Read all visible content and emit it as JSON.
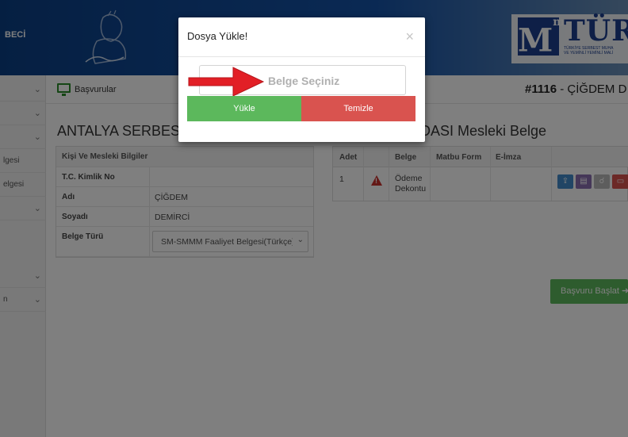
{
  "header": {
    "brand_text": "BECİ",
    "logo_letter": "M",
    "logo_sup": "m",
    "logo_word": "TÜR",
    "logo_sub_line1": "TÜRKİYE SERBEST MUHA",
    "logo_sub_line2": "VE YEMİNLİ YEMİNLİ MALİ"
  },
  "sidebar": {
    "items": [
      {
        "label": "",
        "has_chevron": true
      },
      {
        "label": "",
        "has_chevron": true
      },
      {
        "label": "",
        "has_chevron": true
      },
      {
        "label": "lgesi",
        "has_chevron": false
      },
      {
        "label": "elgesi",
        "has_chevron": false
      },
      {
        "label": "",
        "has_chevron": true
      },
      {
        "label": "",
        "has_chevron": true
      },
      {
        "label": "n",
        "has_chevron": true
      }
    ]
  },
  "breadcrumb": {
    "label": "Başvurular",
    "record_id": "#1116",
    "record_sep": " - ",
    "record_name": "ÇİĞDEM D"
  },
  "page_title": "ANTALYA SERBEST",
  "info_table": {
    "header": "Kişi Ve Mesleki Bilgiler",
    "rows": [
      {
        "label": "T.C. Kimlik No",
        "value": ""
      },
      {
        "label": "Adı",
        "value": "ÇİĞDEM"
      },
      {
        "label": "Soyadı",
        "value": "DEMİRCİ"
      },
      {
        "label": "Belge Türü",
        "value": "SM-SMMM Faaliyet Belgesi(Türkçe)"
      }
    ]
  },
  "docs": {
    "title": "DASI Mesleki Belge",
    "columns": [
      "Adet",
      "",
      "Belge",
      "Matbu Form",
      "E-İmza"
    ],
    "rows": [
      {
        "adet": "1",
        "status_icon": "warning-icon",
        "belge_line1": "Ödeme",
        "belge_line2": "Dekontu",
        "matbu": "",
        "eimza": ""
      }
    ],
    "action_buttons": [
      {
        "icon": "upload-icon",
        "color": "#428bca"
      },
      {
        "icon": "card-icon",
        "color": "#8a6fb1"
      },
      {
        "icon": "search-icon",
        "color": "#bbbbbb"
      },
      {
        "icon": "trash-icon",
        "color": "#d9534f"
      }
    ]
  },
  "start_button": "Başvuru Başlat",
  "modal": {
    "title": "Dosya Yükle!",
    "close": "×",
    "picker_text": "Belge Seçiniz",
    "upload_label": "Yükle",
    "clear_label": "Temizle"
  },
  "colors": {
    "header_blue": "#0f4c9a",
    "success": "#5cb85c",
    "danger": "#d9534f",
    "arrow_red": "#e21f26"
  }
}
